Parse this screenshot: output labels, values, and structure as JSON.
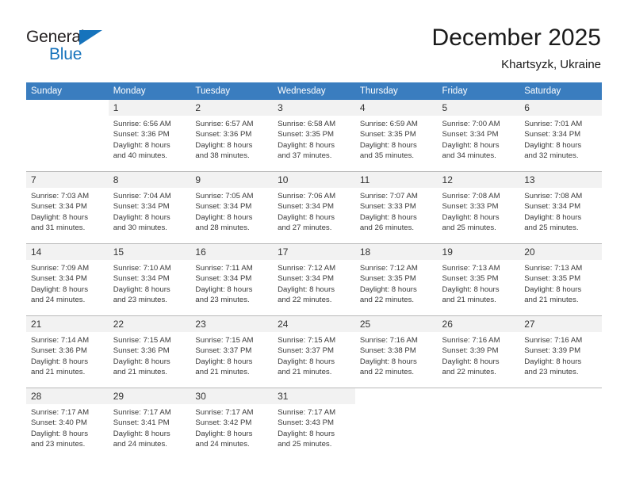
{
  "brand": {
    "name_line1": "General",
    "name_line2": "Blue",
    "accent_color": "#1673bc"
  },
  "header": {
    "title": "December 2025",
    "subtitle": "Khartsyzk, Ukraine"
  },
  "theme": {
    "header_row_color": "#3a7dbf",
    "daynum_band_color": "#f2f2f2",
    "grid_line_color": "#b9b9b9"
  },
  "weekday_headers": [
    "Sunday",
    "Monday",
    "Tuesday",
    "Wednesday",
    "Thursday",
    "Friday",
    "Saturday"
  ],
  "weeks": [
    [
      {
        "day": "",
        "sunrise": "",
        "sunset": "",
        "daylight1": "",
        "daylight2": ""
      },
      {
        "day": "1",
        "sunrise": "Sunrise: 6:56 AM",
        "sunset": "Sunset: 3:36 PM",
        "daylight1": "Daylight: 8 hours",
        "daylight2": "and 40 minutes."
      },
      {
        "day": "2",
        "sunrise": "Sunrise: 6:57 AM",
        "sunset": "Sunset: 3:36 PM",
        "daylight1": "Daylight: 8 hours",
        "daylight2": "and 38 minutes."
      },
      {
        "day": "3",
        "sunrise": "Sunrise: 6:58 AM",
        "sunset": "Sunset: 3:35 PM",
        "daylight1": "Daylight: 8 hours",
        "daylight2": "and 37 minutes."
      },
      {
        "day": "4",
        "sunrise": "Sunrise: 6:59 AM",
        "sunset": "Sunset: 3:35 PM",
        "daylight1": "Daylight: 8 hours",
        "daylight2": "and 35 minutes."
      },
      {
        "day": "5",
        "sunrise": "Sunrise: 7:00 AM",
        "sunset": "Sunset: 3:34 PM",
        "daylight1": "Daylight: 8 hours",
        "daylight2": "and 34 minutes."
      },
      {
        "day": "6",
        "sunrise": "Sunrise: 7:01 AM",
        "sunset": "Sunset: 3:34 PM",
        "daylight1": "Daylight: 8 hours",
        "daylight2": "and 32 minutes."
      }
    ],
    [
      {
        "day": "7",
        "sunrise": "Sunrise: 7:03 AM",
        "sunset": "Sunset: 3:34 PM",
        "daylight1": "Daylight: 8 hours",
        "daylight2": "and 31 minutes."
      },
      {
        "day": "8",
        "sunrise": "Sunrise: 7:04 AM",
        "sunset": "Sunset: 3:34 PM",
        "daylight1": "Daylight: 8 hours",
        "daylight2": "and 30 minutes."
      },
      {
        "day": "9",
        "sunrise": "Sunrise: 7:05 AM",
        "sunset": "Sunset: 3:34 PM",
        "daylight1": "Daylight: 8 hours",
        "daylight2": "and 28 minutes."
      },
      {
        "day": "10",
        "sunrise": "Sunrise: 7:06 AM",
        "sunset": "Sunset: 3:34 PM",
        "daylight1": "Daylight: 8 hours",
        "daylight2": "and 27 minutes."
      },
      {
        "day": "11",
        "sunrise": "Sunrise: 7:07 AM",
        "sunset": "Sunset: 3:33 PM",
        "daylight1": "Daylight: 8 hours",
        "daylight2": "and 26 minutes."
      },
      {
        "day": "12",
        "sunrise": "Sunrise: 7:08 AM",
        "sunset": "Sunset: 3:33 PM",
        "daylight1": "Daylight: 8 hours",
        "daylight2": "and 25 minutes."
      },
      {
        "day": "13",
        "sunrise": "Sunrise: 7:08 AM",
        "sunset": "Sunset: 3:34 PM",
        "daylight1": "Daylight: 8 hours",
        "daylight2": "and 25 minutes."
      }
    ],
    [
      {
        "day": "14",
        "sunrise": "Sunrise: 7:09 AM",
        "sunset": "Sunset: 3:34 PM",
        "daylight1": "Daylight: 8 hours",
        "daylight2": "and 24 minutes."
      },
      {
        "day": "15",
        "sunrise": "Sunrise: 7:10 AM",
        "sunset": "Sunset: 3:34 PM",
        "daylight1": "Daylight: 8 hours",
        "daylight2": "and 23 minutes."
      },
      {
        "day": "16",
        "sunrise": "Sunrise: 7:11 AM",
        "sunset": "Sunset: 3:34 PM",
        "daylight1": "Daylight: 8 hours",
        "daylight2": "and 23 minutes."
      },
      {
        "day": "17",
        "sunrise": "Sunrise: 7:12 AM",
        "sunset": "Sunset: 3:34 PM",
        "daylight1": "Daylight: 8 hours",
        "daylight2": "and 22 minutes."
      },
      {
        "day": "18",
        "sunrise": "Sunrise: 7:12 AM",
        "sunset": "Sunset: 3:35 PM",
        "daylight1": "Daylight: 8 hours",
        "daylight2": "and 22 minutes."
      },
      {
        "day": "19",
        "sunrise": "Sunrise: 7:13 AM",
        "sunset": "Sunset: 3:35 PM",
        "daylight1": "Daylight: 8 hours",
        "daylight2": "and 21 minutes."
      },
      {
        "day": "20",
        "sunrise": "Sunrise: 7:13 AM",
        "sunset": "Sunset: 3:35 PM",
        "daylight1": "Daylight: 8 hours",
        "daylight2": "and 21 minutes."
      }
    ],
    [
      {
        "day": "21",
        "sunrise": "Sunrise: 7:14 AM",
        "sunset": "Sunset: 3:36 PM",
        "daylight1": "Daylight: 8 hours",
        "daylight2": "and 21 minutes."
      },
      {
        "day": "22",
        "sunrise": "Sunrise: 7:15 AM",
        "sunset": "Sunset: 3:36 PM",
        "daylight1": "Daylight: 8 hours",
        "daylight2": "and 21 minutes."
      },
      {
        "day": "23",
        "sunrise": "Sunrise: 7:15 AM",
        "sunset": "Sunset: 3:37 PM",
        "daylight1": "Daylight: 8 hours",
        "daylight2": "and 21 minutes."
      },
      {
        "day": "24",
        "sunrise": "Sunrise: 7:15 AM",
        "sunset": "Sunset: 3:37 PM",
        "daylight1": "Daylight: 8 hours",
        "daylight2": "and 21 minutes."
      },
      {
        "day": "25",
        "sunrise": "Sunrise: 7:16 AM",
        "sunset": "Sunset: 3:38 PM",
        "daylight1": "Daylight: 8 hours",
        "daylight2": "and 22 minutes."
      },
      {
        "day": "26",
        "sunrise": "Sunrise: 7:16 AM",
        "sunset": "Sunset: 3:39 PM",
        "daylight1": "Daylight: 8 hours",
        "daylight2": "and 22 minutes."
      },
      {
        "day": "27",
        "sunrise": "Sunrise: 7:16 AM",
        "sunset": "Sunset: 3:39 PM",
        "daylight1": "Daylight: 8 hours",
        "daylight2": "and 23 minutes."
      }
    ],
    [
      {
        "day": "28",
        "sunrise": "Sunrise: 7:17 AM",
        "sunset": "Sunset: 3:40 PM",
        "daylight1": "Daylight: 8 hours",
        "daylight2": "and 23 minutes."
      },
      {
        "day": "29",
        "sunrise": "Sunrise: 7:17 AM",
        "sunset": "Sunset: 3:41 PM",
        "daylight1": "Daylight: 8 hours",
        "daylight2": "and 24 minutes."
      },
      {
        "day": "30",
        "sunrise": "Sunrise: 7:17 AM",
        "sunset": "Sunset: 3:42 PM",
        "daylight1": "Daylight: 8 hours",
        "daylight2": "and 24 minutes."
      },
      {
        "day": "31",
        "sunrise": "Sunrise: 7:17 AM",
        "sunset": "Sunset: 3:43 PM",
        "daylight1": "Daylight: 8 hours",
        "daylight2": "and 25 minutes."
      },
      {
        "day": "",
        "sunrise": "",
        "sunset": "",
        "daylight1": "",
        "daylight2": ""
      },
      {
        "day": "",
        "sunrise": "",
        "sunset": "",
        "daylight1": "",
        "daylight2": ""
      },
      {
        "day": "",
        "sunrise": "",
        "sunset": "",
        "daylight1": "",
        "daylight2": ""
      }
    ]
  ]
}
